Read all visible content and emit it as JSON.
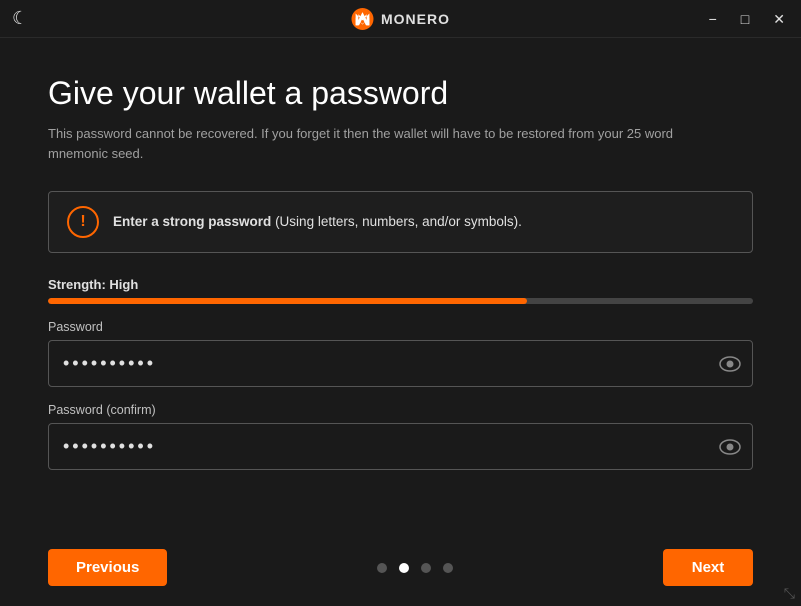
{
  "titleBar": {
    "title": "MONERO",
    "minimizeLabel": "−",
    "maximizeLabel": "□",
    "closeLabel": "✕"
  },
  "page": {
    "title": "Give your wallet a password",
    "subtitle": "This password cannot be recovered. If you forget it then the wallet will have to be restored from your 25 word mnemonic seed.",
    "warningText": "(Using letters, numbers, and/or symbols).",
    "warningBold": "Enter a strong password",
    "strengthLabel": "Strength: High",
    "strengthPercent": 68,
    "passwordLabel": "Password",
    "passwordValue": "••••••••••",
    "passwordConfirmLabel": "Password (confirm)",
    "passwordConfirmValue": "••••••••••"
  },
  "footer": {
    "previousLabel": "Previous",
    "nextLabel": "Next",
    "dots": [
      {
        "active": false
      },
      {
        "active": true
      },
      {
        "active": false
      },
      {
        "active": false
      }
    ]
  },
  "icons": {
    "moon": "☾",
    "warning": "!",
    "eye": "👁",
    "resize": "⤡"
  }
}
